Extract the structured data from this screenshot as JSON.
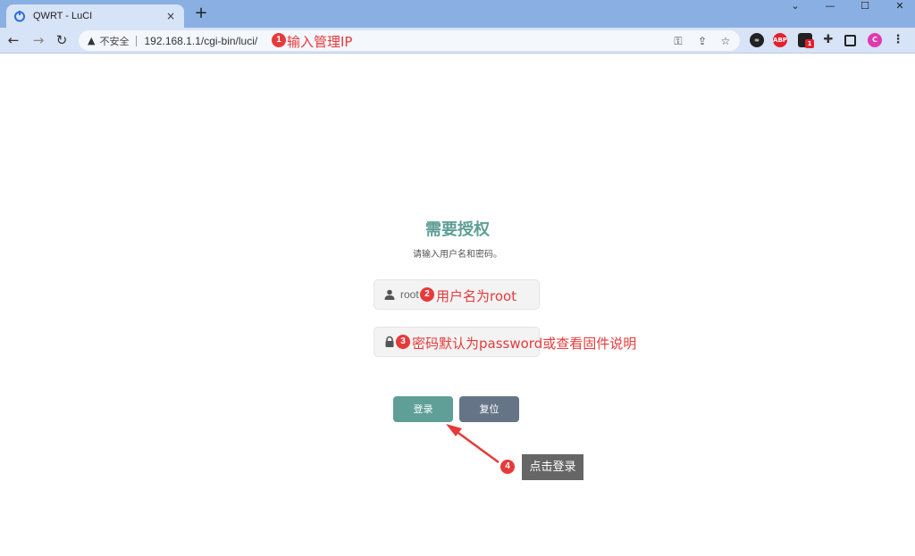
{
  "browser": {
    "tab_title": "QWRT - LuCI",
    "tab_close": "×",
    "new_tab": "+",
    "security_label": "不安全",
    "url": "192.168.1.1/cgi-bin/luci/",
    "abp_label": "ABP",
    "ext_badge": "1",
    "profile_initial": "C"
  },
  "login": {
    "title": "需要授权",
    "subtitle": "请输入用户名和密码。",
    "username_value": "root",
    "login_label": "登录",
    "reset_label": "复位"
  },
  "annotations": [
    {
      "number": "1",
      "text": "输入管理IP"
    },
    {
      "number": "2",
      "text": "用户名为root"
    },
    {
      "number": "3",
      "text": "密码默认为password或查看固件说明"
    },
    {
      "number": "4",
      "text": "点击登录"
    }
  ],
  "colors": {
    "accent": "#5f9f97",
    "reset": "#657587",
    "annotation": "#e63a3a",
    "tab_bar": "#8aafe3",
    "toolbar": "#d7e3f6"
  }
}
